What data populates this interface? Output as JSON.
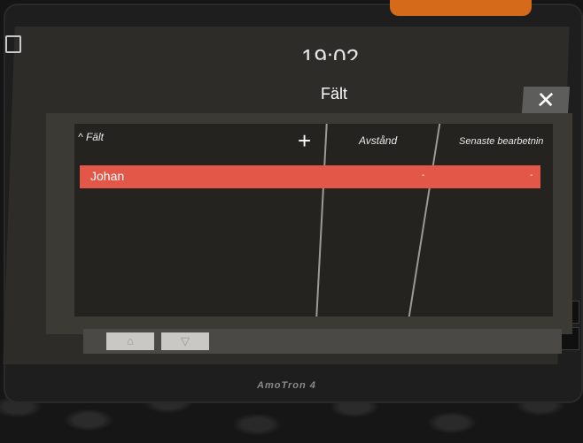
{
  "window": {
    "title": "Fält",
    "time": "19:02"
  },
  "header": {
    "close_label": "✕"
  },
  "table": {
    "columns": [
      {
        "label": "^ Fält"
      },
      {
        "label": "Avstånd"
      },
      {
        "label": "Senaste bearbetnin"
      }
    ],
    "add_label": "+",
    "rows": [
      {
        "name": "Johan",
        "distance": "-",
        "last_processed": "-"
      }
    ]
  },
  "footer": {
    "tool1": "⌂",
    "tool2": "▽"
  },
  "device": {
    "brand": "AmoTron 4"
  },
  "colors": {
    "selected_row": "#e25748",
    "accent_orange": "#d46a1a"
  }
}
